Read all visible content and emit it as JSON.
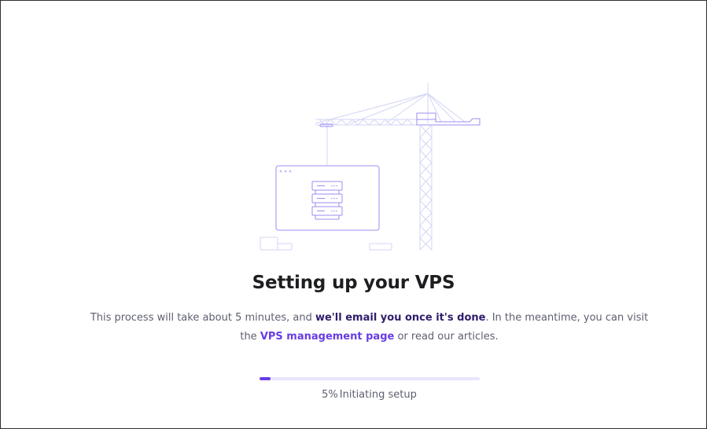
{
  "title": "Setting up your VPS",
  "description": {
    "part1": "This process will take about 5 minutes, and ",
    "bold": "we'll email you once it's done",
    "part2": ". In the meantime, you can visit the ",
    "link": "VPS management page",
    "part3": " or read our articles."
  },
  "progress": {
    "percent": 5,
    "percent_label": "5%",
    "status": "Initiating setup"
  },
  "colors": {
    "accent": "#673de6",
    "track": "#e8e5fc",
    "illustration_stroke": "#9b8ef0",
    "illustration_light": "#d9dcf5"
  }
}
